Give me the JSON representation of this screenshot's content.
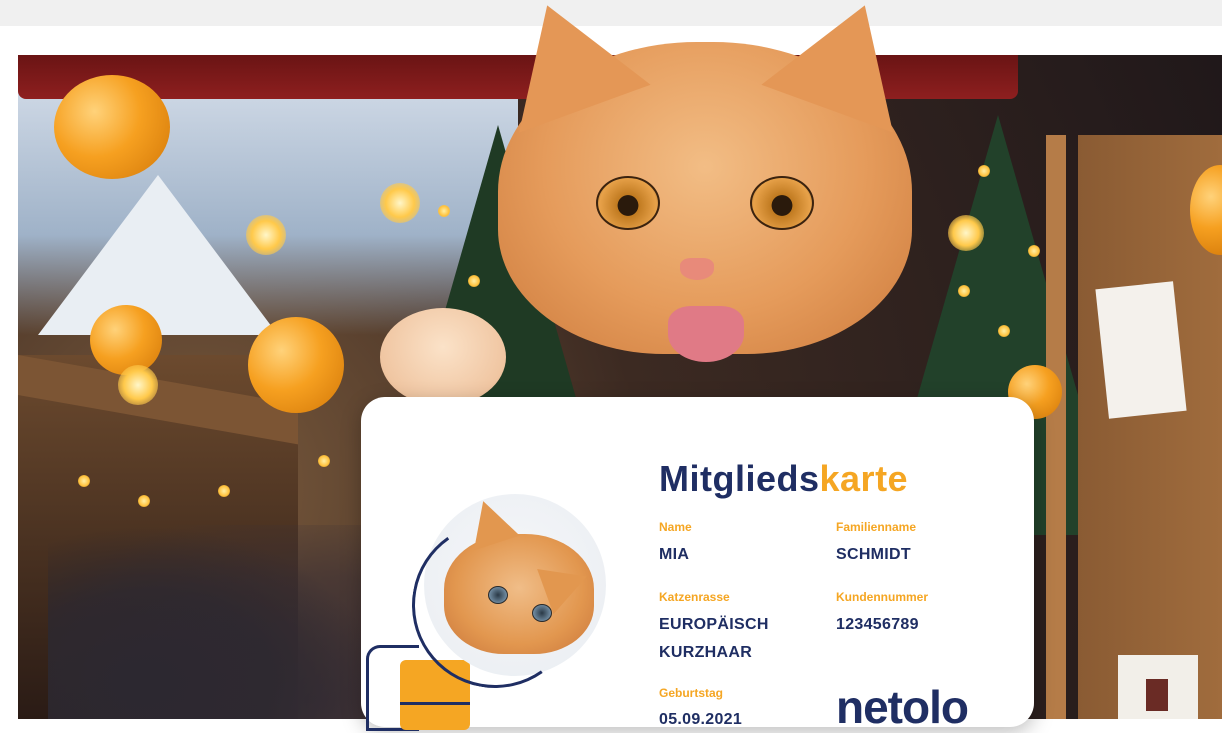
{
  "card": {
    "title_part1": "Mitglieds",
    "title_part2": "karte",
    "fields": {
      "name": {
        "label": "Name",
        "value": "MIA"
      },
      "familienname": {
        "label": "Familienname",
        "value": "SCHMIDT"
      },
      "katzenrasse": {
        "label": "Katzenrasse",
        "value_line1": "EUROPÄISCH",
        "value_line2": "KURZHAAR"
      },
      "kundennummer": {
        "label": "Kundennummer",
        "value": "123456789"
      },
      "geburtstag": {
        "label": "Geburtstag",
        "value": "05.09.2021"
      }
    },
    "logo": "netolo"
  },
  "colors": {
    "navy": "#1f2e63",
    "orange": "#f5a623",
    "card_background": "#ffffff",
    "page_topbar": "#f0f0f0"
  },
  "scene": {
    "icon": "cat-photo",
    "subject": "orange-tabby-kitten",
    "setting": "christmas-market"
  }
}
